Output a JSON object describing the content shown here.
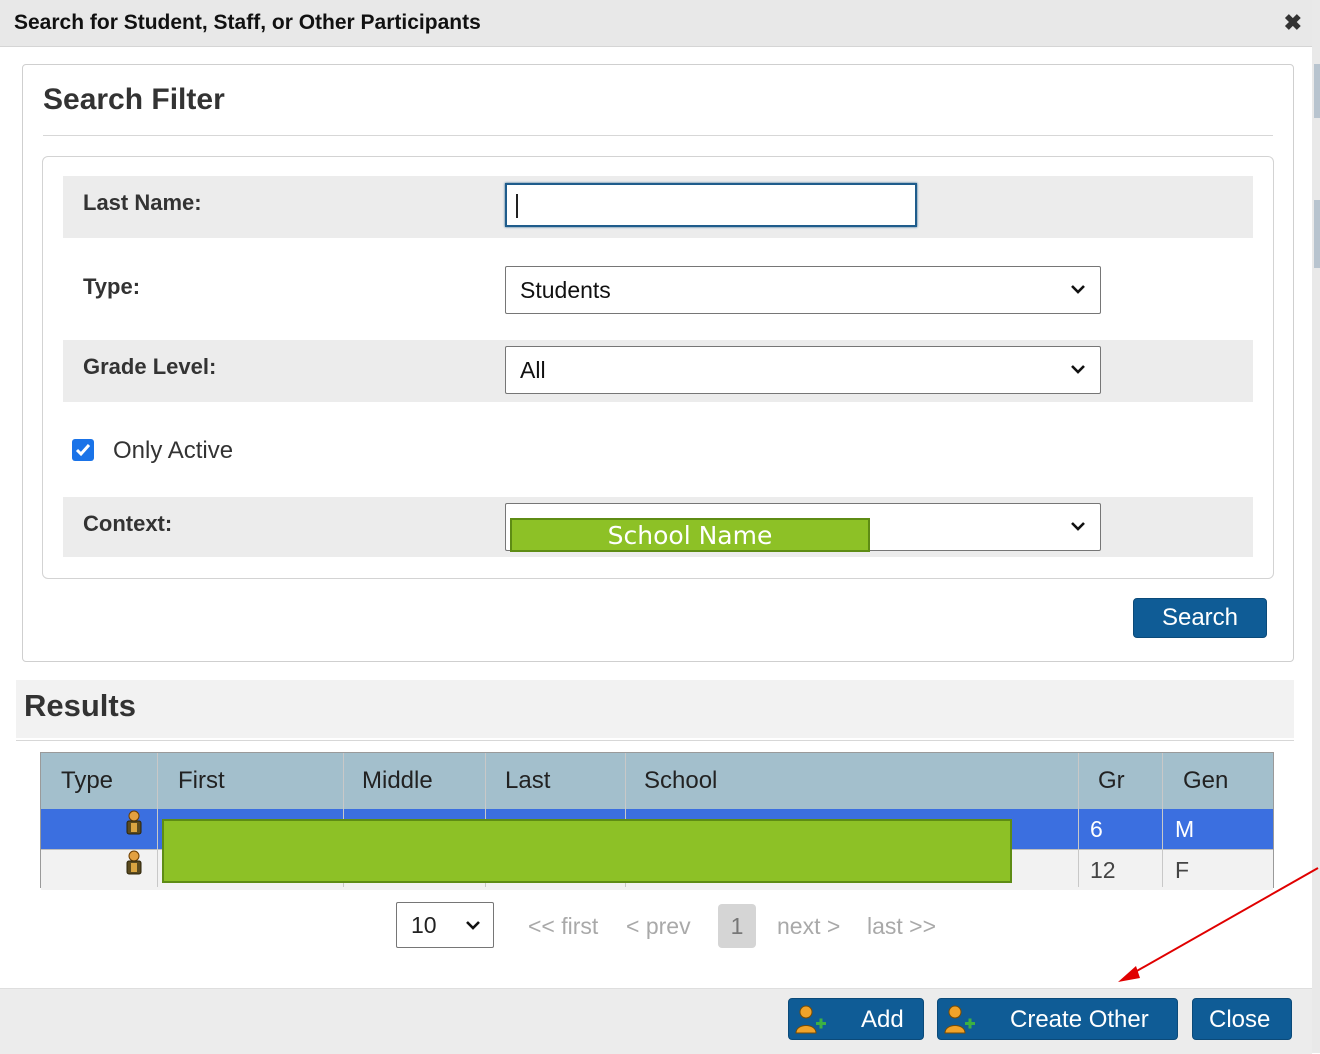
{
  "dialog": {
    "title": "Search for Student, Staff, or Other Participants",
    "close_glyph": "✖"
  },
  "filter": {
    "title": "Search Filter",
    "last_name_label": "Last Name:",
    "last_name_value": "",
    "type_label": "Type:",
    "type_value": "Students",
    "grade_label": "Grade Level:",
    "grade_value": "All",
    "only_active_label": "Only Active",
    "only_active_checked": true,
    "context_label": "Context:",
    "context_value": "School Name",
    "search_button": "Search"
  },
  "results": {
    "title": "Results",
    "columns": [
      "Type",
      "First",
      "Middle",
      "Last",
      "School",
      "Gr",
      "Gen"
    ],
    "rows": [
      {
        "type_icon": "student-icon",
        "gr": "6",
        "gen": "M",
        "selected": true
      },
      {
        "type_icon": "student-icon",
        "gr": "12",
        "gen": "F",
        "selected": false
      }
    ]
  },
  "pager": {
    "page_size": "10",
    "first": "<< first",
    "prev": "< prev",
    "current": "1",
    "next": "next >",
    "last": "last >>"
  },
  "footer": {
    "add_label": "Add",
    "create_other_label": "Create Other",
    "close_label": "Close"
  },
  "colors": {
    "primary": "#0f5c96",
    "selected_row": "#3b6fe0",
    "header_row": "#a3bfcc",
    "redaction": "#8dc126",
    "annotation_arrow": "#e00000"
  }
}
